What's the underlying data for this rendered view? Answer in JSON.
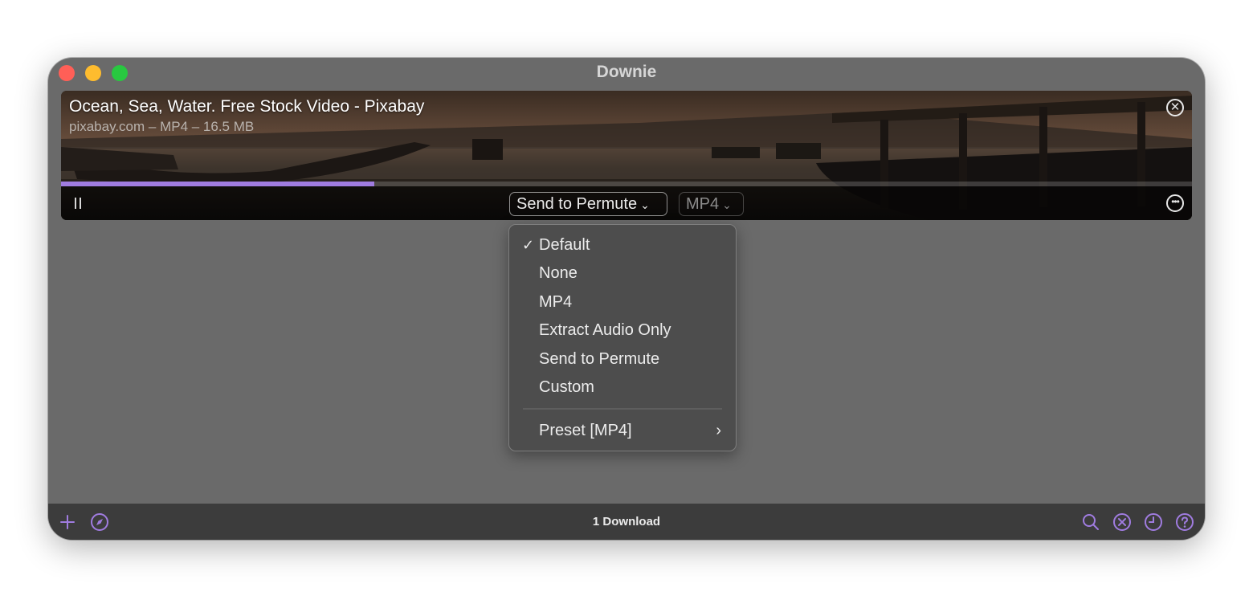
{
  "window": {
    "title": "Downie"
  },
  "download": {
    "title": "Ocean, Sea, Water. Free Stock Video - Pixabay",
    "subtitle": "pixabay.com – MP4 – 16.5 MB",
    "progress": 0.277,
    "postprocessing_label": "Send to Permute",
    "format_label": "MP4"
  },
  "menu": {
    "items": [
      {
        "label": "Default",
        "checked": true
      },
      {
        "label": "None"
      },
      {
        "label": "MP4"
      },
      {
        "label": "Extract Audio Only"
      },
      {
        "label": "Send to Permute"
      },
      {
        "label": "Custom"
      }
    ],
    "submenu_label": "Preset [MP4]",
    "check_glyph": "✓",
    "submenu_glyph": "›"
  },
  "footer": {
    "status": "1 Download"
  },
  "icons": {
    "window": [
      "close-window-icon",
      "minimize-window-icon",
      "zoom-window-icon"
    ],
    "download": [
      "pause-icon",
      "remove-download-icon",
      "more-options-icon"
    ],
    "footer_left": [
      "add-icon",
      "browser-compass-icon"
    ],
    "footer_right": [
      "search-icon",
      "cancel-all-icon",
      "history-clock-icon",
      "help-icon"
    ]
  },
  "colors": {
    "accent": "#a07ce0",
    "window_bg": "#6a6a6a",
    "footer_bg": "#3c3c3c",
    "menu_bg": "#4d4d4d"
  }
}
